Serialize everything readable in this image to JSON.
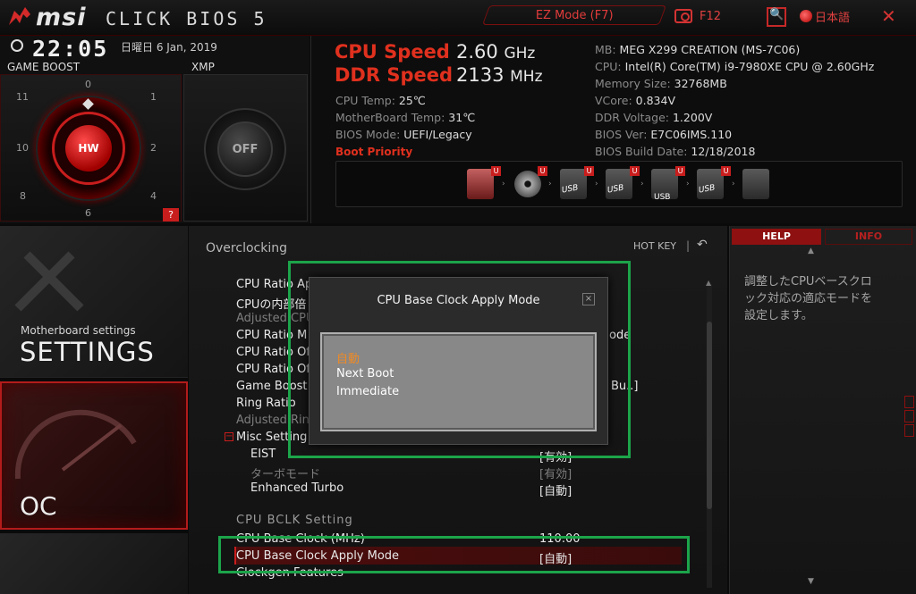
{
  "topbar": {
    "brand": "msi",
    "product": "CLICK BIOS 5",
    "ez_mode_label": "EZ Mode (F7)",
    "screenshot_key": "F12",
    "language": "日本語"
  },
  "status": {
    "time": "22:05",
    "date": "日曜日  6 Jan, 2019"
  },
  "game_boost": {
    "label": "GAME BOOST",
    "knob_label": "HW",
    "dial_numbers": [
      "0",
      "1",
      "2",
      "4",
      "6",
      "8",
      "10",
      "11"
    ],
    "help_badge": "?"
  },
  "xmp": {
    "label": "XMP",
    "knob_label": "OFF"
  },
  "speeds": {
    "cpu_label": "CPU Speed",
    "cpu_value": "2.60",
    "cpu_unit": "GHz",
    "ddr_label": "DDR Speed",
    "ddr_value": "2133",
    "ddr_unit": "MHz"
  },
  "temps": [
    {
      "label": "CPU Temp: ",
      "value": "25℃"
    },
    {
      "label": "MotherBoard Temp: ",
      "value": "31℃"
    },
    {
      "label": "BIOS Mode: ",
      "value": "UEFI/",
      "value2": "Legacy"
    }
  ],
  "system_info": [
    {
      "label": "MB: ",
      "value": "MEG X299 CREATION (MS-7C06)"
    },
    {
      "label": "CPU: ",
      "value": "Intel(R) Core(TM) i9-7980XE CPU @ 2.60GHz"
    },
    {
      "label": "Memory Size: ",
      "value": "32768MB"
    },
    {
      "label": "VCore: ",
      "value": "0.834V"
    },
    {
      "label": "DDR Voltage: ",
      "value": "1.200V"
    },
    {
      "label": "BIOS Ver: ",
      "value": "E7C06IMS.110"
    },
    {
      "label": "BIOS Build Date: ",
      "value": "12/18/2018"
    }
  ],
  "boot": {
    "label": "Boot Priority",
    "badge": "U",
    "usb_text": "USB",
    "devices": [
      "hdd",
      "disc",
      "usb-disc",
      "usb-disc",
      "usb-key",
      "usb-floppy",
      "network"
    ]
  },
  "nav": {
    "settings_sub": "Motherboard settings",
    "settings_title": "SETTINGS",
    "oc_title": "OC"
  },
  "main": {
    "breadcrumb": "Overclocking",
    "hotkey": "HOT KEY",
    "hotkey_sep": "|",
    "rows": [
      {
        "label": "CPU Ratio Ap",
        "value": "",
        "dim": false,
        "sub": false
      },
      {
        "label": "CPUの内部倍",
        "value": "",
        "dim": false,
        "sub": false
      },
      {
        "label": "Adjusted CPU",
        "value": "",
        "dim": true,
        "sub": false
      },
      {
        "label": "CPU Ratio M",
        "value": "ode",
        "dim": false,
        "sub": false
      },
      {
        "label": "CPU Ratio Of",
        "value": "",
        "dim": false,
        "sub": false
      },
      {
        "label": "CPU Ratio Of",
        "value": "",
        "dim": false,
        "sub": false
      },
      {
        "label": "Game Boost",
        "value": "Bu..]",
        "dim": false,
        "sub": false
      },
      {
        "label": "Ring Ratio",
        "value": "",
        "dim": false,
        "sub": false
      },
      {
        "label": "Adjusted Rin",
        "value": "",
        "dim": true,
        "sub": false
      },
      {
        "label": "Misc Setting",
        "value": "",
        "dim": false,
        "sub": false
      },
      {
        "label": "EIST",
        "value": "[有効]",
        "dim": false,
        "sub": true
      },
      {
        "label": "ターボモード",
        "value": "[有効]",
        "dim": true,
        "sub": true
      },
      {
        "label": "Enhanced Turbo",
        "value": "[自動]",
        "dim": false,
        "sub": true
      }
    ],
    "section_bclk": "CPU  BCLK  Setting",
    "bclk_rows": [
      {
        "label": "CPU Base Clock (MHz)",
        "value": "110.00"
      },
      {
        "label": "CPU Base Clock Apply Mode",
        "value": "[自動]"
      },
      {
        "label": "Clockgen Features",
        "value": ""
      }
    ]
  },
  "dialog": {
    "title": "CPU Base Clock Apply Mode",
    "close": "×",
    "options": [
      "自動",
      "Next Boot",
      "Immediate"
    ],
    "selected_index": 0
  },
  "help": {
    "tab_help": "HELP",
    "tab_info": "INFO",
    "text": "調整したCPUベースクロック対応の適応モードを設定します。"
  }
}
